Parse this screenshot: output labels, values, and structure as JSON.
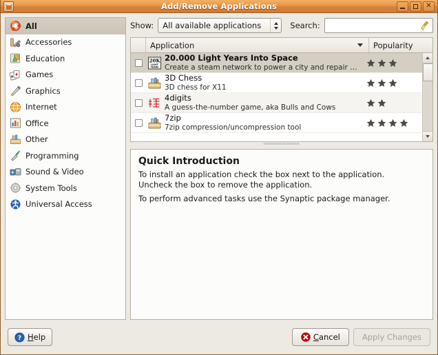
{
  "window": {
    "title": "Add/Remove Applications",
    "icon": "package-icon",
    "buttons": [
      {
        "name": "minimize-button",
        "label": "_"
      },
      {
        "name": "maximize-button",
        "label": "□"
      },
      {
        "name": "close-button",
        "label": "✕"
      }
    ]
  },
  "sidebar": {
    "items": [
      {
        "label": "All",
        "icon": "ubuntu-logo-icon",
        "selected": true
      },
      {
        "label": "Accessories",
        "icon": "accessories-icon",
        "selected": false
      },
      {
        "label": "Education",
        "icon": "education-icon",
        "selected": false
      },
      {
        "label": "Games",
        "icon": "games-icon",
        "selected": false
      },
      {
        "label": "Graphics",
        "icon": "graphics-icon",
        "selected": false
      },
      {
        "label": "Internet",
        "icon": "internet-icon",
        "selected": false
      },
      {
        "label": "Office",
        "icon": "office-icon",
        "selected": false
      },
      {
        "label": "Other",
        "icon": "other-icon",
        "selected": false
      },
      {
        "label": "Programming",
        "icon": "programming-icon",
        "selected": false
      },
      {
        "label": "Sound & Video",
        "icon": "sound-video-icon",
        "selected": false
      },
      {
        "label": "System Tools",
        "icon": "system-tools-icon",
        "selected": false
      },
      {
        "label": "Universal Access",
        "icon": "universal-access-icon",
        "selected": false
      }
    ]
  },
  "toolbar": {
    "show_label": "Show:",
    "show_value": "All available applications",
    "search_label": "Search:",
    "search_value": "",
    "search_placeholder": "",
    "clear_icon": "broom-icon"
  },
  "list": {
    "columns": [
      {
        "key": "check",
        "label": ""
      },
      {
        "key": "application",
        "label": "Application",
        "sorted": true,
        "sort_dir": "descending"
      },
      {
        "key": "popularity",
        "label": "Popularity"
      }
    ],
    "rows": [
      {
        "checked": false,
        "selected": true,
        "icon": "20k-light-years-icon",
        "name": "20.000 Light Years Into Space",
        "description": "Create a steam network to power a city and repair in ...",
        "popularity": 3
      },
      {
        "checked": false,
        "selected": false,
        "icon": "toolbox-icon",
        "name": "3D Chess",
        "description": "3D chess for X11",
        "popularity": 3
      },
      {
        "checked": false,
        "selected": false,
        "icon": "4digits-icon",
        "name": "4digits",
        "description": "A guess-the-number game, aka Bulls and Cows",
        "popularity": 2
      },
      {
        "checked": false,
        "selected": false,
        "icon": "toolbox-icon",
        "name": "7zip",
        "description": "7zip compression/uncompression tool",
        "popularity": 4
      }
    ],
    "scrollbar": {
      "position": "top"
    }
  },
  "intro": {
    "title": "Quick Introduction",
    "paragraph1": "To install an application check the box next to the application. Uncheck the box to remove the application.",
    "paragraph2": "To perform advanced tasks use the Synaptic package manager."
  },
  "footer": {
    "help_label": "Help",
    "help_mnemonic": "H",
    "help_icon": "help-circle-icon",
    "cancel_label": "Cancel",
    "cancel_mnemonic": "C",
    "cancel_icon": "cancel-circle-icon",
    "apply_label": "Apply Changes",
    "apply_enabled": false
  },
  "colors": {
    "titlebar": "#e6964a",
    "selection": "#d5cec2",
    "window_bg": "#edeae4",
    "panel_bg": "#fcfcfb",
    "border": "#b6b0a5",
    "cancel_red": "#cc0000"
  }
}
